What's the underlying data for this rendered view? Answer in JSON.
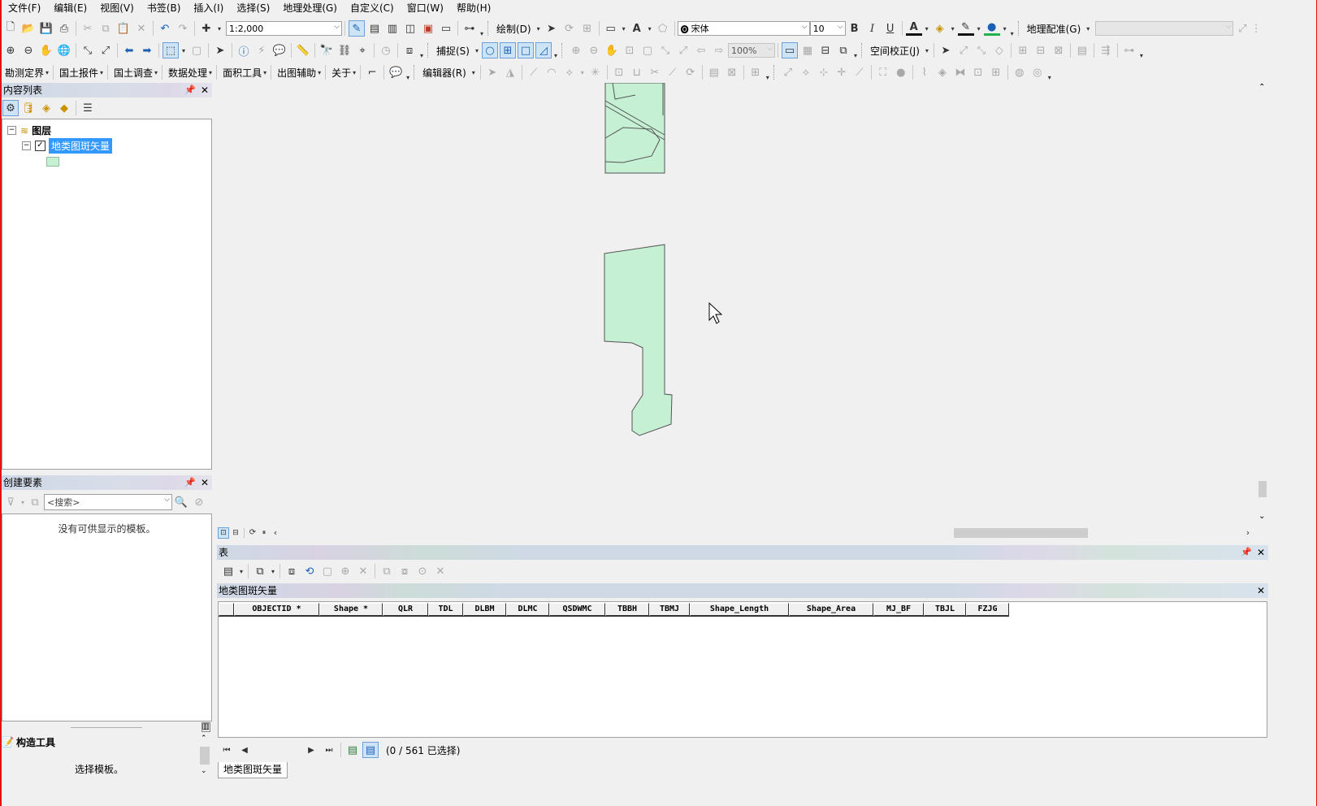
{
  "menu": [
    "文件(F)",
    "编辑(E)",
    "视图(V)",
    "书签(B)",
    "插入(I)",
    "选择(S)",
    "地理处理(G)",
    "自定义(C)",
    "窗口(W)",
    "帮助(H)"
  ],
  "toolbar1": {
    "scale": "1:2,000",
    "draw_label": "绘制(D)",
    "font_name": "宋体",
    "font_size": "10",
    "bold": "B",
    "italic": "I",
    "underline": "U",
    "font_color": "A",
    "georef_label": "地理配准(G)"
  },
  "toolbar2": {
    "snap_label": "捕捉(S)",
    "zoom_pct": "100%",
    "spatial_adj_label": "空间校正(J)"
  },
  "toolbar3": {
    "items": [
      "勘测定界",
      "国土报件",
      "国土调查",
      "数据处理",
      "面积工具",
      "出图辅助",
      "关于"
    ],
    "editor_label": "编辑器(R)"
  },
  "toc": {
    "title": "内容列表",
    "root_label": "图层",
    "layer_label": "地类图斑矢量",
    "layer_checked": "✓"
  },
  "create_features": {
    "title": "创建要素",
    "search_placeholder": "<搜索>",
    "empty_message": "没有可供显示的模板。"
  },
  "construct_tools": {
    "title": "构造工具",
    "message": "选择模板。"
  },
  "table": {
    "title": "表",
    "tab_title": "地类图斑矢量",
    "columns": [
      "OBJECTID *",
      "Shape *",
      "QLR",
      "TDL",
      "DLBM",
      "DLMC",
      "QSDWMC",
      "TBBH",
      "TBMJ",
      "Shape_Length",
      "Shape_Area",
      "MJ_BF",
      "TBJL",
      "FZJG"
    ],
    "status": "(0 / 561 已选择)",
    "bottom_tab": "地类图斑矢量"
  },
  "colors": {
    "polygon_fill": "#c6f0d4",
    "polygon_stroke": "#555555",
    "selection": "#3399ff",
    "window_border": "#e01414"
  }
}
